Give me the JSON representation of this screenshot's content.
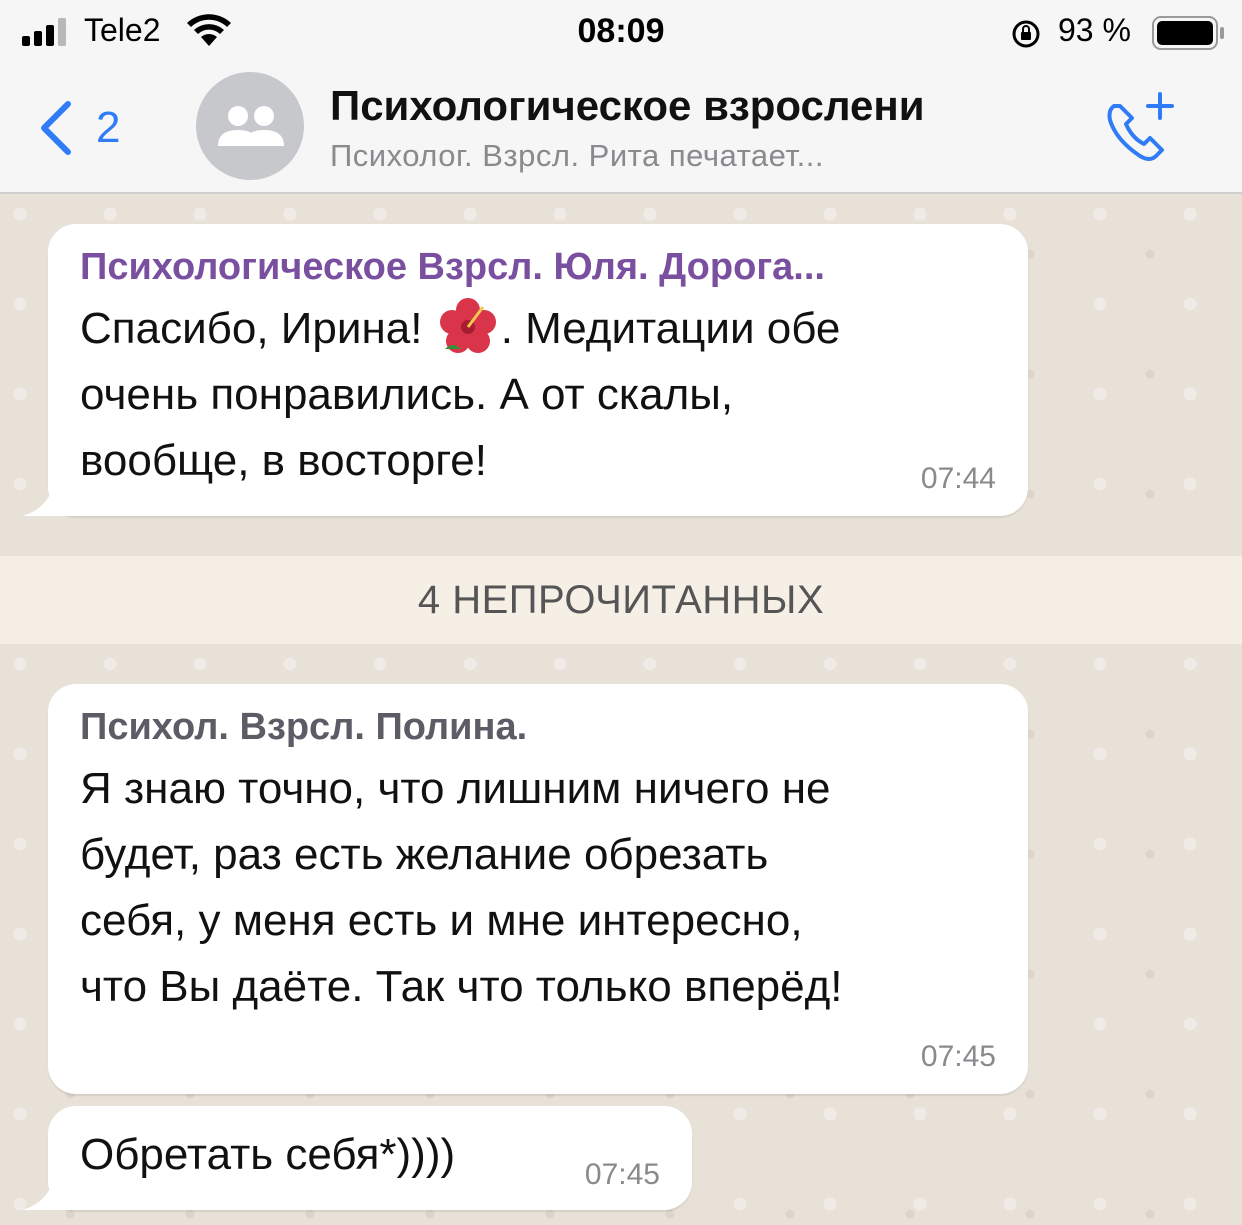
{
  "status_bar": {
    "carrier": "Tele2",
    "time": "08:09",
    "battery_percent": "93 %"
  },
  "header": {
    "back_count": "2",
    "title": "Психологическое взрослени",
    "subtitle": "Психолог. Взрсл. Рита печатает..."
  },
  "messages": [
    {
      "sender": "Психологическое Взрсл. Юля. Дорога...",
      "sender_color": "#7a4fa0",
      "line1a": "Спасибо, Ирина!",
      "line1b": ". Медитации обе",
      "line2": "очень понравились. А от скалы,",
      "line3": "вообще, в восторге!",
      "time": "07:44"
    },
    {
      "sender": "Психол. Взрсл. Полина.",
      "sender_color": "#5c5c66",
      "line1": "Я знаю точно, что лишним ничего не",
      "line2": "будет, раз есть желание обрезать",
      "line3": "себя, у меня есть и мне интересно,",
      "line4": "что Вы даёте.  Так что только вперёд!",
      "time": "07:45"
    },
    {
      "text": "Обретать себя*))))",
      "time": "07:45"
    }
  ],
  "unread_label": "4 НЕПРОЧИТАННЫХ",
  "colors": {
    "accent": "#2f7cf6",
    "bubble": "#ffffff",
    "chat_bg": "#e8e1d8"
  }
}
